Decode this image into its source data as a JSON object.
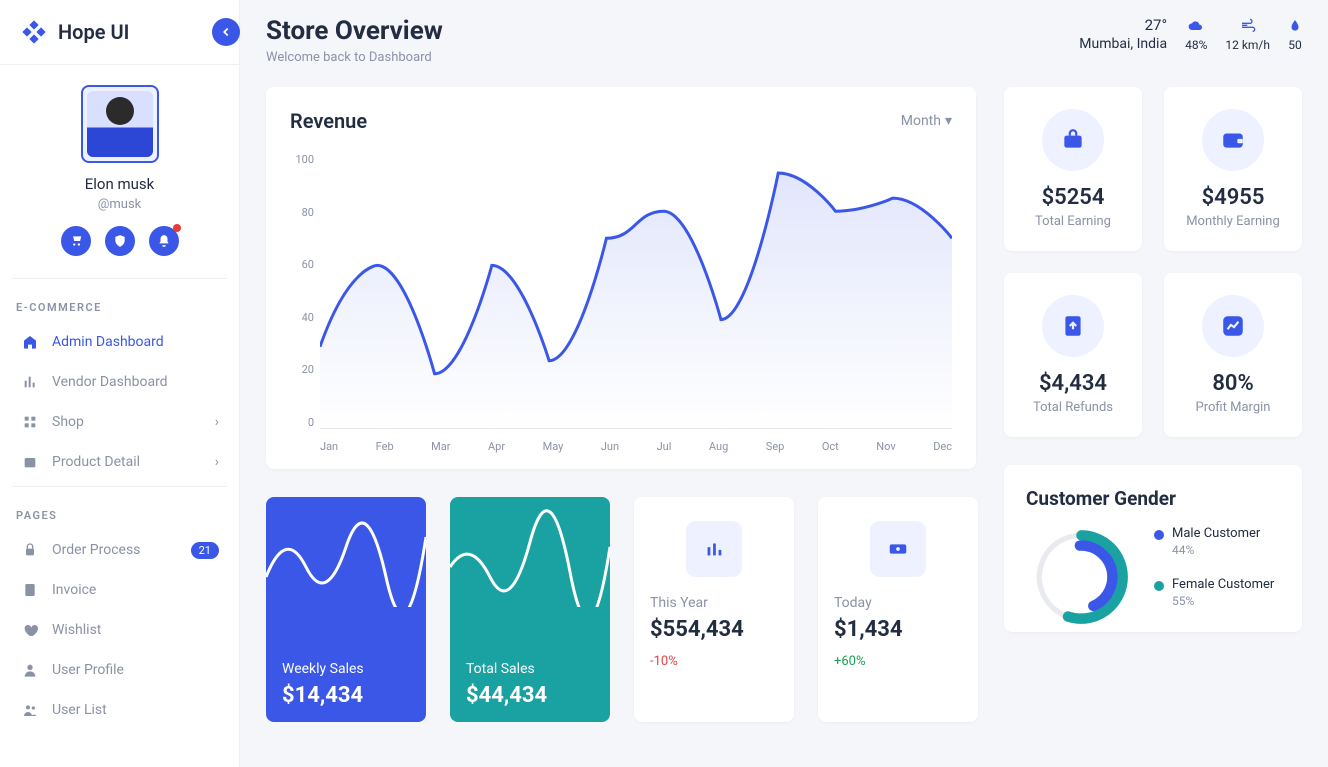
{
  "brand": "Hope UI",
  "profile": {
    "name": "Elon musk",
    "handle": "@musk"
  },
  "sections": {
    "ecommerce_title": "E-COMMERCE",
    "pages_title": "PAGES"
  },
  "nav_ecom": [
    {
      "label": "Admin Dashboard",
      "active": true
    },
    {
      "label": "Vendor Dashboard"
    },
    {
      "label": "Shop",
      "chevron": true
    },
    {
      "label": "Product Detail",
      "chevron": true
    }
  ],
  "nav_pages": [
    {
      "label": "Order Process",
      "badge": "21"
    },
    {
      "label": "Invoice"
    },
    {
      "label": "Wishlist"
    },
    {
      "label": "User Profile"
    },
    {
      "label": "User List"
    }
  ],
  "header": {
    "title": "Store Overview",
    "subtitle": "Welcome back to Dashboard"
  },
  "weather": {
    "temp": "27°",
    "location": "Mumbai, India",
    "humidity": "48%",
    "wind": "12 km/h",
    "precip": "50"
  },
  "revenue": {
    "title": "Revenue",
    "dropdown": "Month"
  },
  "chart_data": {
    "type": "line",
    "categories": [
      "Jan",
      "Feb",
      "Mar",
      "Apr",
      "May",
      "Jun",
      "Jul",
      "Aug",
      "Sep",
      "Oct",
      "Nov",
      "Dec"
    ],
    "values": [
      30,
      60,
      20,
      60,
      25,
      70,
      80,
      40,
      94,
      80,
      85,
      70
    ],
    "ylabel": "",
    "xlabel": "",
    "ylim": [
      0,
      100
    ],
    "yticks": [
      100,
      80,
      60,
      40,
      20,
      0
    ],
    "title": "Revenue"
  },
  "kpis": [
    {
      "value": "$5254",
      "label": "Total Earning",
      "icon": "briefcase"
    },
    {
      "value": "$4955",
      "label": "Monthly Earning",
      "icon": "wallet"
    },
    {
      "value": "$4,434",
      "label": "Total Refunds",
      "icon": "upload"
    },
    {
      "value": "80%",
      "label": "Profit Margin",
      "icon": "trend"
    }
  ],
  "sales": [
    {
      "title": "Weekly Sales",
      "value": "$14,434",
      "color": "blue"
    },
    {
      "title": "Total Sales",
      "value": "$44,434",
      "color": "teal"
    }
  ],
  "stats": [
    {
      "label": "This Year",
      "value": "$554,434",
      "delta": "-10%",
      "dir": "neg",
      "icon": "bars"
    },
    {
      "label": "Today",
      "value": "$1,434",
      "delta": "+60%",
      "dir": "pos",
      "icon": "money"
    }
  ],
  "gender": {
    "title": "Customer Gender",
    "legend": [
      {
        "label": "Male Customer",
        "value": "44%",
        "color": "male"
      },
      {
        "label": "Female Customer",
        "value": "55%",
        "color": "teal"
      }
    ]
  }
}
